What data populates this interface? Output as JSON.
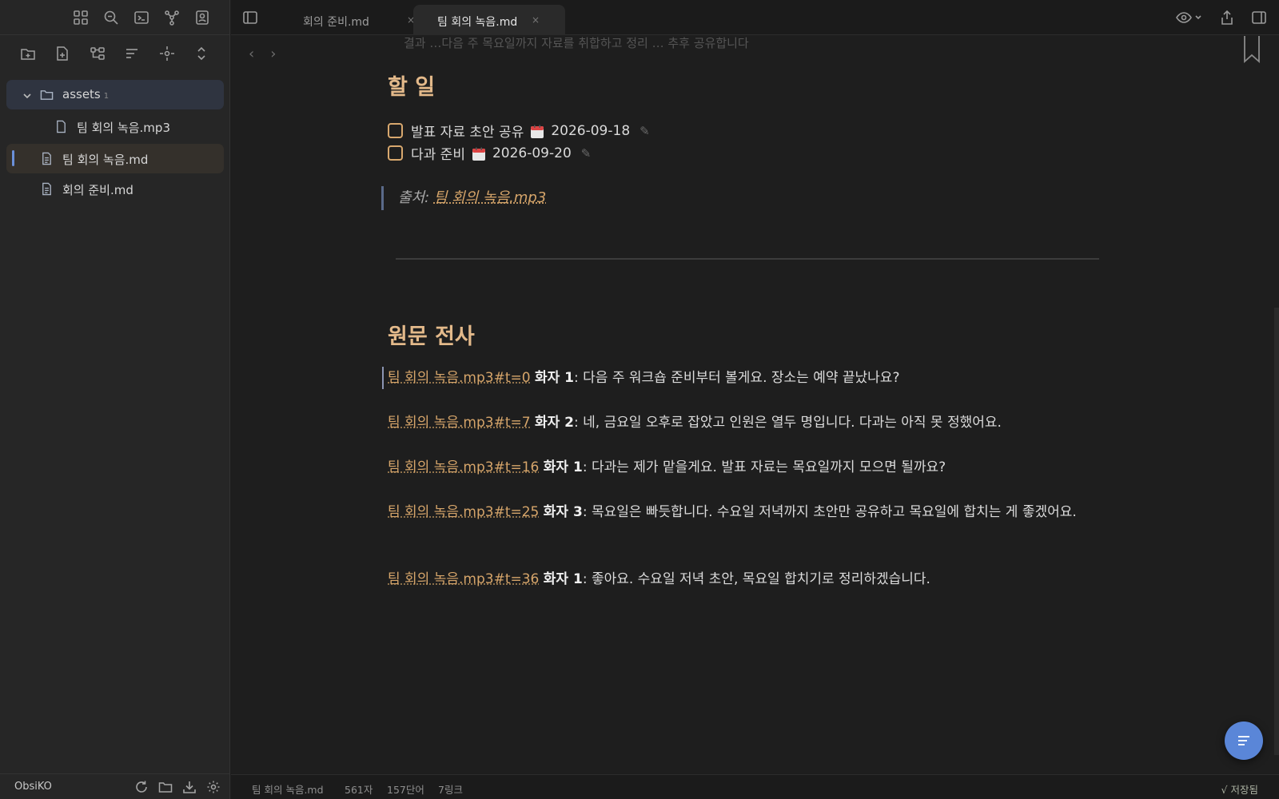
{
  "sidebar": {
    "tree": {
      "folder": {
        "label": "assets",
        "count": "1"
      },
      "folder_child": {
        "label": "팀 회의 녹음.mp3"
      },
      "active_file": {
        "label": "팀 회의 녹음.md"
      },
      "file": {
        "label": "회의 준비.md"
      }
    },
    "vault_name": "ObsiKO"
  },
  "tabs": {
    "inactive": {
      "label": "회의 준비.md"
    },
    "active": {
      "label": "팀 회의 녹음.md"
    },
    "close_glyph": "×"
  },
  "editor": {
    "cut_line": "결과 …다음 주 목요일까지 자료를 취합하고 정리 … 추후 공유합니다",
    "todo_heading": "할 일",
    "tasks": [
      {
        "text": "발표 자료 초안 공유",
        "date": "2026-09-18"
      },
      {
        "text": "다과 준비",
        "date": "2026-09-20"
      }
    ],
    "edit_glyph": "✎",
    "quote": {
      "prefix": "출처: ",
      "link": "팀 회의 녹음.mp3"
    },
    "transcript_heading": "원문 전사",
    "transcript": [
      {
        "ts": "팀 회의 녹음.mp3#t=0",
        "speaker": "화자 1",
        "text": ": 다음 주 워크숍 준비부터 볼게요. 장소는 예약 끝났나요?"
      },
      {
        "ts": "팀 회의 녹음.mp3#t=7",
        "speaker": "화자 2",
        "text": ": 네, 금요일 오후로 잡았고 인원은 열두 명입니다. 다과는 아직 못 정했어요."
      },
      {
        "ts": "팀 회의 녹음.mp3#t=16",
        "speaker": "화자 1",
        "text": ": 다과는 제가 맡을게요. 발표 자료는 목요일까지 모으면 될까요?"
      },
      {
        "ts": "팀 회의 녹음.mp3#t=25",
        "speaker": "화자 3",
        "text": ": 목요일은 빠듯합니다. 수요일 저녁까지 초안만 공유하고 목요일에 합치는 게 좋겠어요."
      },
      {
        "ts": "팀 회의 녹음.mp3#t=36",
        "speaker": "화자 1",
        "text": ": 좋아요. 수요일 저녁 초안, 목요일 합치기로 정리하겠습니다."
      }
    ]
  },
  "statusbar": {
    "file": "팀 회의 녹음.md",
    "chars": "561자",
    "words": "157단어",
    "links": "7링크",
    "saved": "√ 저장됨"
  },
  "colors": {
    "accent": "#5a86d8",
    "heading": "#e3b98a",
    "link": "#d6a56a"
  }
}
